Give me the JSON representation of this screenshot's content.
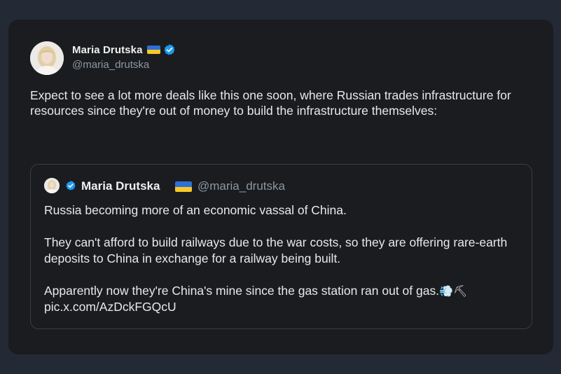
{
  "author": {
    "display_name": "Maria Drutska",
    "handle": "@maria_drutska",
    "flag": "ukraine-flag",
    "verified": true
  },
  "tweet": {
    "text": "Expect to see a lot more deals like this one soon, where Russian trades infrastructure for resources since they're out of money to build the infrastructure themselves:"
  },
  "quoted": {
    "display_name": "Maria Drutska",
    "handle": "@maria_drutska",
    "paragraphs": [
      "Russia becoming more of an economic vassal of China.",
      "They can't afford to build railways due to the war costs, so they are offering rare-earth deposits to China in exchange for a railway being built."
    ],
    "last_line_text": "Apparently now they're China's mine since the gas station ran out of gas.",
    "emojis": "💨⛏",
    "link": "pic.x.com/AzDckFGQcU"
  },
  "colors": {
    "background": "#232a36",
    "card": "#1a1c1f",
    "text": "#e7e9ea",
    "muted": "#8b98a5",
    "verified": "#1d9bf0",
    "flag_blue": "#2f6fd6",
    "flag_yellow": "#f7c82a"
  }
}
